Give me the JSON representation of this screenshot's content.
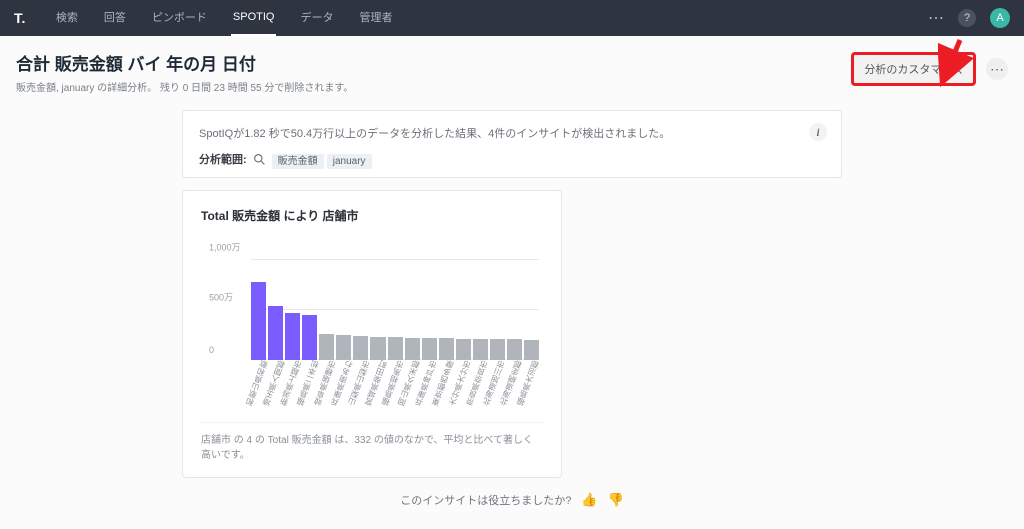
{
  "nav": {
    "logo": "T.",
    "items": [
      "検索",
      "回答",
      "ピンボード",
      "SPOTIQ",
      "データ",
      "管理者"
    ],
    "active_index": 3,
    "avatar_letter": "A"
  },
  "header": {
    "title": "合計 販売金額 バイ 年の月 日付",
    "subtitle": "販売金額, january の詳細分析。 残り 0 日間 23 時間 55 分で削除されます。",
    "customize_label": "分析のカスタマイズ"
  },
  "summary": {
    "text": "SpotIQが1.82 秒で50.4万行以上のデータを分析した結果、4件のインサイトが検出されました。",
    "scope_label": "分析範囲:",
    "pills": [
      "販売金額",
      "january"
    ]
  },
  "insight": {
    "title": "Total 販売金額 により 店舗市",
    "description": "店舗市 の 4 の Total 販売金額 は、332 の値のなかで、平均と比べて著しく高いです。"
  },
  "feedback": {
    "prompt": "このインサイトは役立ちましたか?"
  },
  "chart_data": {
    "type": "bar",
    "title": "Total 販売金額 により 店舗市",
    "ylabel": "",
    "ylim": [
      0,
      10000000
    ],
    "yticks": [
      {
        "v": 0,
        "label": "0"
      },
      {
        "v": 5000000,
        "label": "500万"
      },
      {
        "v": 10000000,
        "label": "1,000万"
      }
    ],
    "categories": [
      "和歌山県和歌山市",
      "埼玉県入間郡越生町",
      "新潟県上越市",
      "福島県二本松市",
      "岐阜県瑞穂市",
      "兵庫県南あわじ市",
      "山梨県山梨市",
      "宮城県柴田町",
      "福島県相馬市",
      "岡山県久米郡",
      "兵庫県神戸市北区",
      "東京都西多摩郡",
      "大分県大分市",
      "奈良県奈良市",
      "北海道旭川市",
      "北海道網走郡",
      "福島県大沼郡会津美里町"
    ],
    "values": [
      7800000,
      5400000,
      4700000,
      4500000,
      2600000,
      2500000,
      2400000,
      2350000,
      2300000,
      2250000,
      2200000,
      2180000,
      2150000,
      2120000,
      2100000,
      2080000,
      2050000
    ],
    "highlight_indices": [
      0,
      1,
      2,
      3
    ]
  }
}
